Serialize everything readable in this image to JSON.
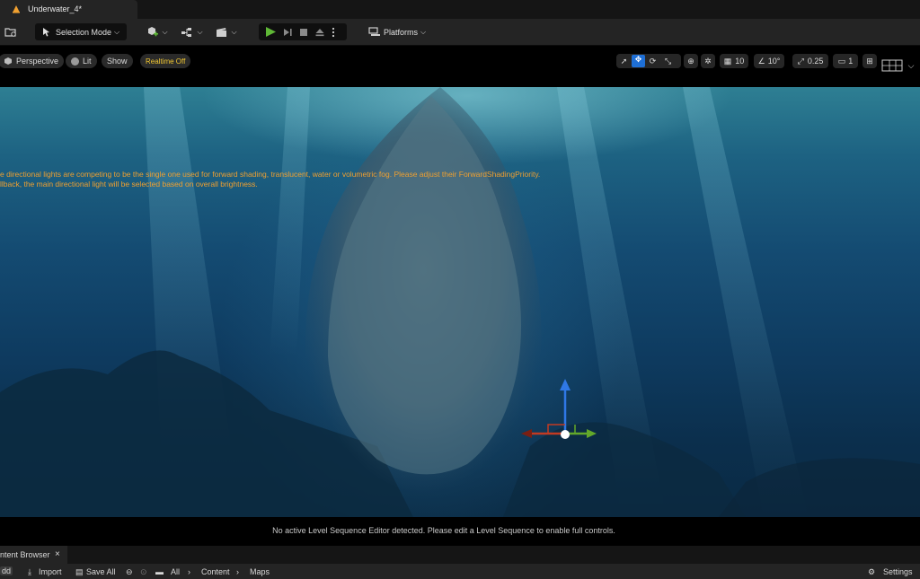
{
  "document_tab": {
    "title": "Underwater_4*"
  },
  "toolbar": {
    "selection_mode": "Selection Mode",
    "platforms": "Platforms"
  },
  "viewport": {
    "perspective": "Perspective",
    "lit": "Lit",
    "show": "Show",
    "realtime": "Realtime Off",
    "grid_size": "10",
    "rotation_snap": "10°",
    "scale_snap": "0.25",
    "camera_speed": "1"
  },
  "warnings": {
    "line1": "e directional lights are competing to be the single one used for forward shading, translucent, water or volumetric fog. Please adjust their ForwardShadingPriority.",
    "line2": "llback, the main directional light will be selected based on overall brightness."
  },
  "status_message": "No active Level Sequence Editor detected. Please edit a Level Sequence to enable full controls.",
  "content_browser": {
    "tab_title": "ntent Browser",
    "close": "×",
    "add": "dd",
    "import": "Import",
    "save_all": "Save All",
    "breadcrumbs": [
      "All",
      "Content",
      "Maps"
    ],
    "settings": "Settings"
  },
  "colors": {
    "accent_play": "#5fb836",
    "warning_text": "#f0a030",
    "realtime_text": "#f2c832",
    "gizmo_z": "#2f78e6",
    "gizmo_x": "#c23a22",
    "gizmo_y": "#63a82a"
  }
}
